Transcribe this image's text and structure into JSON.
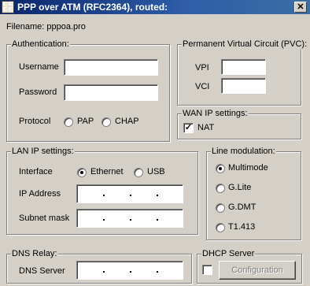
{
  "window": {
    "title": "PPP over ATM (RFC2364), routed:",
    "icon_letters": [
      "C",
      "C",
      "C",
      "C"
    ],
    "close_glyph": "✕"
  },
  "filename": {
    "label": "Filename:",
    "value": "pppoa.pro"
  },
  "auth": {
    "legend": "Authentication:",
    "username_label": "Username",
    "username_value": "",
    "password_label": "Password",
    "password_value": "",
    "protocol_label": "Protocol",
    "options": [
      "PAP",
      "CHAP"
    ],
    "selected": ""
  },
  "pvc": {
    "legend": "Permanent Virtual Circuit (PVC):",
    "vpi_label": "VPI",
    "vpi_value": "",
    "vci_label": "VCI",
    "vci_value": ""
  },
  "wan": {
    "legend": "WAN IP settings:",
    "nat_label": "NAT",
    "nat_checked": true
  },
  "lan": {
    "legend": "LAN IP settings:",
    "interface_label": "Interface",
    "interfaces": [
      "Ethernet",
      "USB"
    ],
    "selected_interface": "Ethernet",
    "ip_label": "IP Address",
    "mask_label": "Subnet mask"
  },
  "modulation": {
    "legend": "Line modulation:",
    "options": [
      "Multimode",
      "G.Lite",
      "G.DMT",
      "T1.413"
    ],
    "selected": "Multimode"
  },
  "dns": {
    "legend": "DNS Relay:",
    "server_label": "DNS Server"
  },
  "dhcp": {
    "legend": "DHCP Server",
    "config_button": "Configuration",
    "enabled": false
  }
}
